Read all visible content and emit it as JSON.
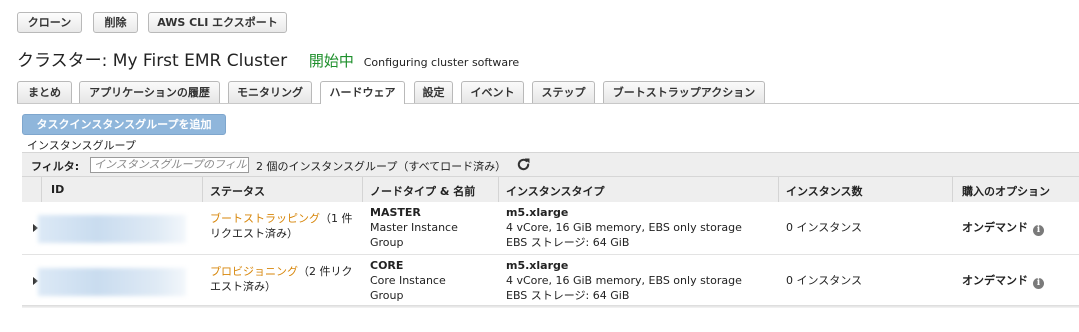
{
  "toolbar": {
    "clone_label": "クローン",
    "delete_label": "削除",
    "export_label": "AWS CLI エクスポート"
  },
  "header": {
    "title": "クラスター: My First EMR Cluster",
    "state": "開始中",
    "state_detail": "Configuring cluster software",
    "state_color": "#1d8f2b"
  },
  "tabs": [
    {
      "label": "まとめ"
    },
    {
      "label": "アプリケーションの履歴"
    },
    {
      "label": "モニタリング"
    },
    {
      "label": "ハードウェア",
      "active": true
    },
    {
      "label": "設定"
    },
    {
      "label": "イベント"
    },
    {
      "label": "ステップ"
    },
    {
      "label": "ブートストラップアクション"
    }
  ],
  "hardware": {
    "add_button_label": "タスクインスタンスグループを追加",
    "section_label": "インスタンスグループ",
    "filter_label": "フィルタ:",
    "filter_placeholder": "インスタンスグループのフィルタ",
    "filter_summary": "2 個のインスタンスグループ（すべてロード済み）",
    "refresh_icon": "refresh-icon",
    "columns": [
      "ID",
      "ステータス",
      "ノードタイプ & 名前",
      "インスタンスタイプ",
      "インスタンス数",
      "購入のオプション"
    ],
    "rows": [
      {
        "status": "ブートストラッピング",
        "status_detail_1": "（1 件",
        "status_detail_2": "リクエスト済み）",
        "node_type": "MASTER",
        "node_name_1": "Master Instance",
        "node_name_2": "Group",
        "instance_type": "m5.xlarge",
        "instance_spec": "4 vCore, 16 GiB memory, EBS only storage",
        "ebs_storage": "EBS ストレージ:  64 GiB",
        "instance_count": "0 インスタンス",
        "purchase_option": "オンデマンド"
      },
      {
        "status": "プロビジョニング",
        "status_detail_1": "（2 件リク",
        "status_detail_2": "エスト済み）",
        "node_type": "CORE",
        "node_name_1": "Core Instance",
        "node_name_2": "Group",
        "instance_type": "m5.xlarge",
        "instance_spec": "4 vCore, 16 GiB memory, EBS only storage",
        "ebs_storage": "EBS ストレージ:  64 GiB",
        "instance_count": "0 インスタンス",
        "purchase_option": "オンデマンド"
      }
    ],
    "status_color": "#d7860a",
    "accent_button_color": "#8fb6db"
  }
}
